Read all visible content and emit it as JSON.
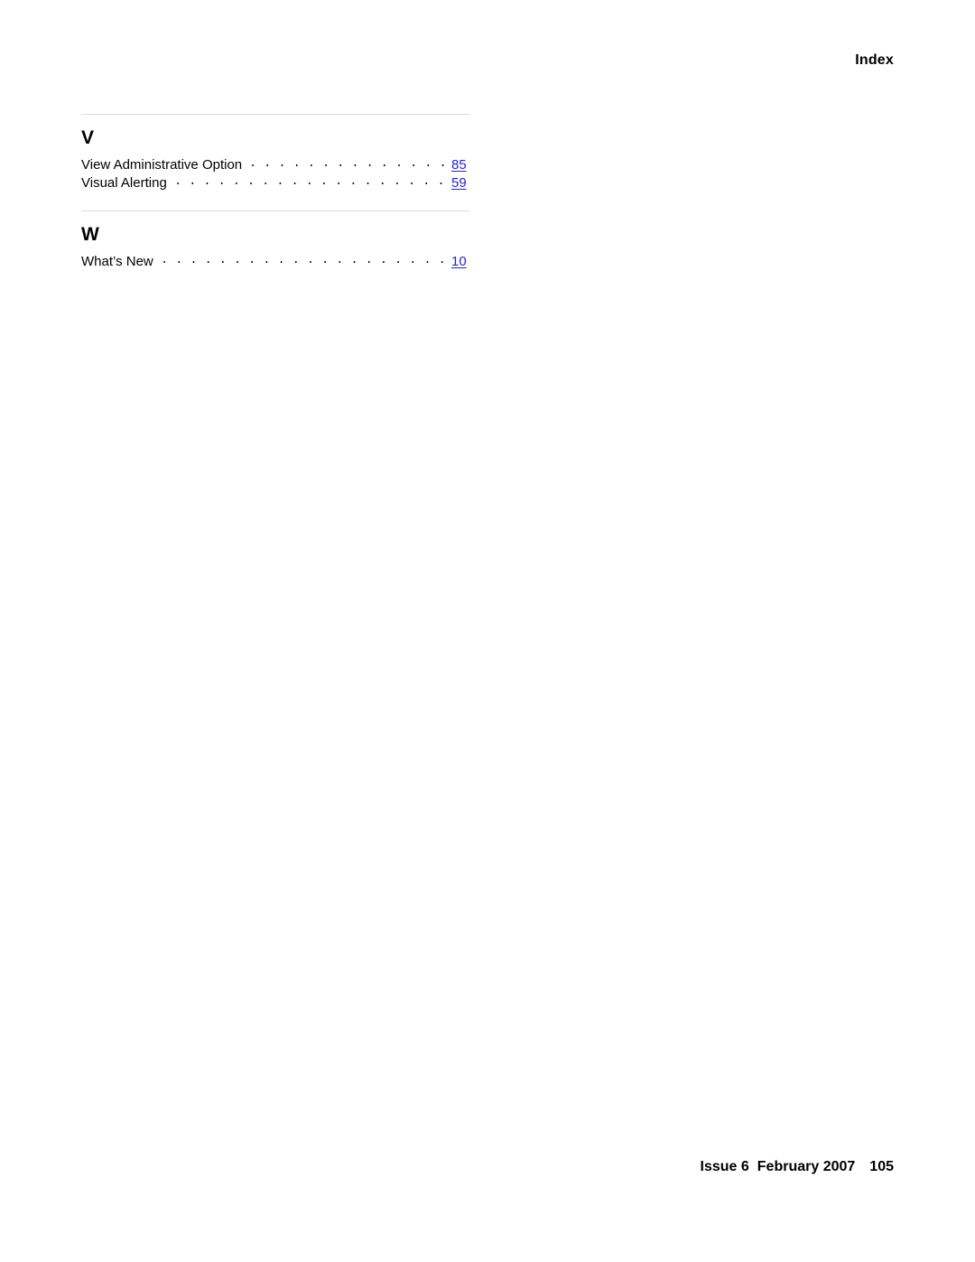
{
  "header": {
    "title": "Index"
  },
  "index": {
    "sections": [
      {
        "letter": "V",
        "entries": [
          {
            "title": "View Administrative Option",
            "page": "85"
          },
          {
            "title": "Visual Alerting",
            "page": "59"
          }
        ]
      },
      {
        "letter": "W",
        "entries": [
          {
            "title": "What’s New",
            "page": "10"
          }
        ]
      }
    ]
  },
  "footer": {
    "issue": "Issue 6",
    "date": "February 2007",
    "page_number": "105"
  }
}
